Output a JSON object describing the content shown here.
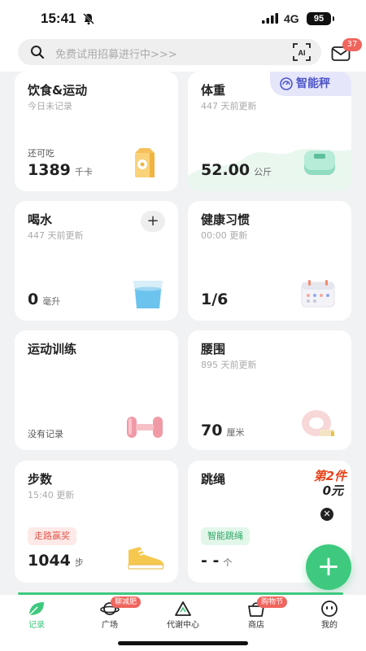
{
  "status": {
    "time": "15:41",
    "network": "4G",
    "battery": "95"
  },
  "search": {
    "placeholder": "免费试用招募进行中>>>",
    "mail_badge": "37"
  },
  "cards": {
    "diet": {
      "title": "饮食&运动",
      "sub": "今日未记录",
      "label": "还可吃",
      "value": "1389",
      "unit": "千卡"
    },
    "weight": {
      "title": "体重",
      "sub": "447 天前更新",
      "tag": "智能秤",
      "value": "52.00",
      "unit": "公斤"
    },
    "water": {
      "title": "喝水",
      "sub": "447 天前更新",
      "plus": "+",
      "value": "0",
      "unit": "毫升"
    },
    "habits": {
      "title": "健康习惯",
      "sub": "00:00 更新",
      "value": "1/6"
    },
    "training": {
      "title": "运动训练",
      "label": "没有记录"
    },
    "waist": {
      "title": "腰围",
      "sub": "895 天前更新",
      "value": "70",
      "unit": "厘米"
    },
    "steps": {
      "title": "步数",
      "sub": "15:40 更新",
      "pill": "走路赢奖",
      "value": "1044",
      "unit": "步"
    },
    "rope": {
      "title": "跳绳",
      "pill": "智能跳绳",
      "value": "- -",
      "unit": "个",
      "promo_line1": "第2件",
      "promo_line2": "0元",
      "close": "✕"
    }
  },
  "fab": "+",
  "tabs": [
    {
      "label": "记录",
      "icon": "leaf-icon",
      "active": true
    },
    {
      "label": "广场",
      "icon": "planet-icon",
      "badge": "聊减肥"
    },
    {
      "label": "代谢中心",
      "icon": "triangle-icon"
    },
    {
      "label": "商店",
      "icon": "shop-icon",
      "badge": "购物节"
    },
    {
      "label": "我的",
      "icon": "face-icon"
    }
  ],
  "colors": {
    "accent": "#3ec97f",
    "badge": "#f0655e",
    "scale_tag": "#4d55c9",
    "steps_pill": "#e25a4f",
    "rope_pill": "#2fa866"
  }
}
